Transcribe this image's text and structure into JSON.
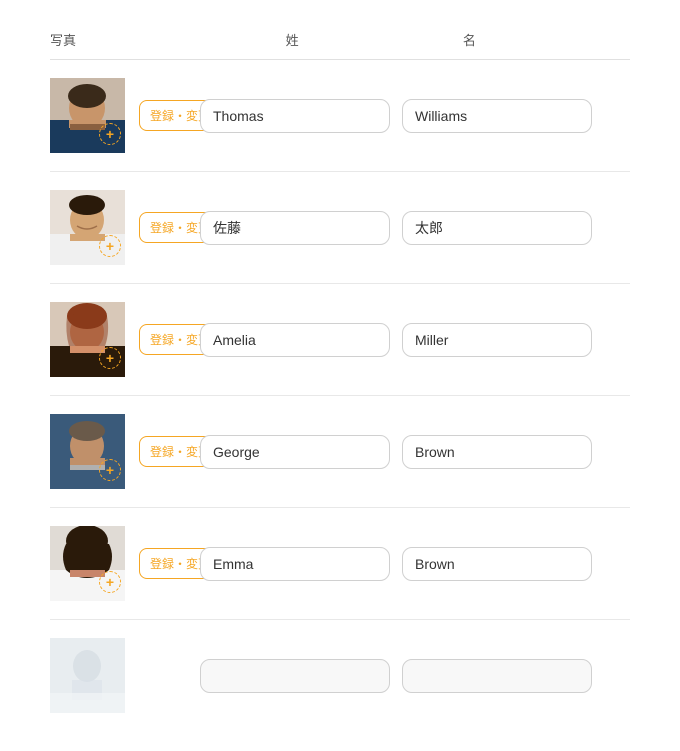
{
  "header": {
    "col_photo": "写真",
    "col_last": "姓",
    "col_first": "名"
  },
  "button_label": "登録・変更",
  "persons": [
    {
      "id": 1,
      "last_name": "Thomas",
      "first_name": "Williams",
      "has_photo": true,
      "photo_color1": "#8B6355",
      "photo_color2": "#A0796A"
    },
    {
      "id": 2,
      "last_name": "佐藤",
      "first_name": "太郎",
      "has_photo": true,
      "photo_color1": "#5a7a8a",
      "photo_color2": "#7a9aaa"
    },
    {
      "id": 3,
      "last_name": "Amelia",
      "first_name": "Miller",
      "has_photo": true,
      "photo_color1": "#b06060",
      "photo_color2": "#c08070"
    },
    {
      "id": 4,
      "last_name": "George",
      "first_name": "Brown",
      "has_photo": true,
      "photo_color1": "#4a5a6a",
      "photo_color2": "#6a7a8a"
    },
    {
      "id": 5,
      "last_name": "Emma",
      "first_name": "Brown",
      "has_photo": true,
      "photo_color1": "#7a5545",
      "photo_color2": "#9a7565"
    },
    {
      "id": 6,
      "last_name": "",
      "first_name": "",
      "has_photo": true,
      "photo_color1": "#c0c8d0",
      "photo_color2": "#d8e0e8"
    }
  ]
}
